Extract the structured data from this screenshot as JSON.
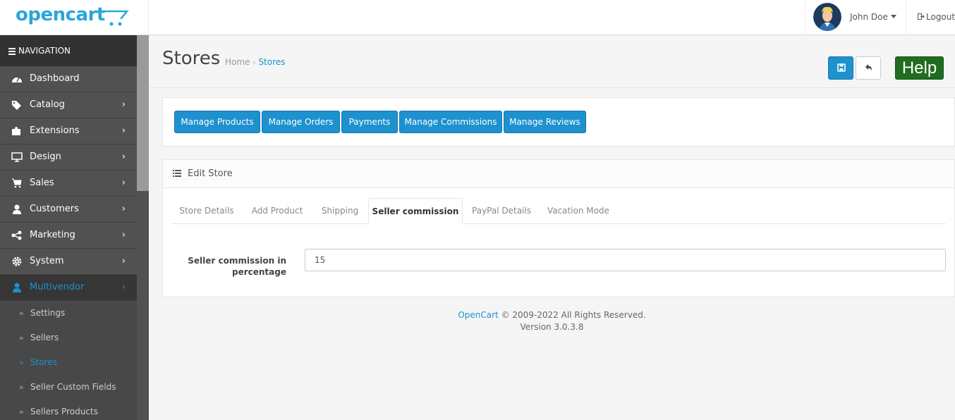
{
  "header": {
    "logo_text": "opencart",
    "user_name": "John Doe",
    "logout_label": "Logout"
  },
  "nav": {
    "title": "NAVIGATION",
    "items": [
      {
        "label": "Dashboard",
        "icon": "dashboard-icon"
      },
      {
        "label": "Catalog",
        "icon": "tags-icon"
      },
      {
        "label": "Extensions",
        "icon": "puzzle-icon"
      },
      {
        "label": "Design",
        "icon": "desktop-icon"
      },
      {
        "label": "Sales",
        "icon": "cart-icon"
      },
      {
        "label": "Customers",
        "icon": "user-icon"
      },
      {
        "label": "Marketing",
        "icon": "share-icon"
      },
      {
        "label": "System",
        "icon": "cog-icon"
      },
      {
        "label": "Multivendor",
        "icon": "user-icon"
      }
    ],
    "sub_items": [
      "Settings",
      "Sellers",
      "Stores",
      "Seller Custom Fields",
      "Sellers Products"
    ]
  },
  "page": {
    "title": "Stores",
    "breadcrumb": [
      "Home",
      "Stores"
    ],
    "help_label": "Help"
  },
  "toolbar": {
    "buttons": [
      "Manage Products",
      "Manage Orders",
      "Payments",
      "Manage Commissions",
      "Manage Reviews"
    ]
  },
  "panel": {
    "title": "Edit Store",
    "tabs": [
      "Store Details",
      "Add Product",
      "Shipping",
      "Seller commission",
      "PayPal Details",
      "Vacation Mode"
    ],
    "active_tab": "Seller commission",
    "field_label": "Seller commission in percentage",
    "field_value": "15"
  },
  "footer": {
    "link": "OpenCart",
    "copyright": "© 2009-2022 All Rights Reserved.",
    "version": "Version 3.0.3.8"
  },
  "colors": {
    "primary": "#1e91cf",
    "sidebar": "#515151",
    "help": "#1f6e1f"
  }
}
